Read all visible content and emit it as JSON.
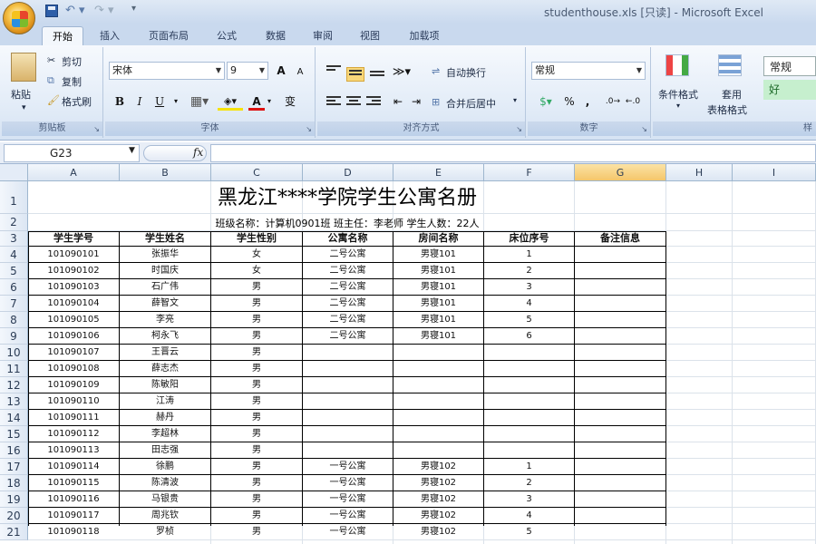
{
  "window": {
    "title": "studenthouse.xls  [只读]  -  Microsoft Excel"
  },
  "quick_access": {
    "save_icon": "save-icon",
    "undo_icon": "undo-icon",
    "redo_icon": "redo-icon"
  },
  "tabs": [
    "开始",
    "插入",
    "页面布局",
    "公式",
    "数据",
    "审阅",
    "视图",
    "加载项"
  ],
  "active_tab": "开始",
  "ribbon": {
    "clipboard": {
      "label": "剪贴板",
      "paste": "粘贴",
      "cut": "剪切",
      "copy": "复制",
      "format_painter": "格式刷"
    },
    "font": {
      "label": "字体",
      "font_name": "宋体",
      "font_size": "9",
      "grow": "A",
      "shrink": "A",
      "bold": "B",
      "italic": "I",
      "underline": "U",
      "font_color": "A",
      "phonetic": "变"
    },
    "alignment": {
      "label": "对齐方式",
      "wrap_text": "自动换行",
      "merge_center": "合并后居中"
    },
    "number": {
      "label": "数字",
      "format": "常规",
      "percent": "%",
      "comma": ","
    },
    "styles": {
      "conditional_format": "条件格式",
      "format_as_table_line1": "套用",
      "format_as_table_line2": "表格格式",
      "style_normal": "常规",
      "style_good": "好",
      "label": "样"
    }
  },
  "formula_bar": {
    "name_box": "G23",
    "fx": "fx",
    "content": ""
  },
  "grid": {
    "columns": [
      "A",
      "B",
      "C",
      "D",
      "E",
      "F",
      "G",
      "H",
      "I"
    ],
    "selected_column": "G",
    "rows": [
      "1",
      "2",
      "3",
      "4",
      "5",
      "6",
      "7",
      "8",
      "9",
      "10",
      "11",
      "12",
      "13",
      "14",
      "15",
      "16",
      "17",
      "18",
      "19",
      "20",
      "21"
    ]
  },
  "sheet": {
    "title": "黑龙江****学院学生公寓名册",
    "subtitle": "班级名称：计算机0901班  班主任：李老师  学生人数：22人",
    "headers": [
      "学生学号",
      "学生姓名",
      "学生性别",
      "公寓名称",
      "房间名称",
      "床位序号",
      "备注信息"
    ],
    "rows": [
      [
        "101090101",
        "张振华",
        "女",
        "二号公寓",
        "男寝101",
        "1",
        ""
      ],
      [
        "101090102",
        "时国庆",
        "女",
        "二号公寓",
        "男寝101",
        "2",
        ""
      ],
      [
        "101090103",
        "石广伟",
        "男",
        "二号公寓",
        "男寝101",
        "3",
        ""
      ],
      [
        "101090104",
        "薛智文",
        "男",
        "二号公寓",
        "男寝101",
        "4",
        ""
      ],
      [
        "101090105",
        "李亮",
        "男",
        "二号公寓",
        "男寝101",
        "5",
        ""
      ],
      [
        "101090106",
        "柯永飞",
        "男",
        "二号公寓",
        "男寝101",
        "6",
        ""
      ],
      [
        "101090107",
        "王晋云",
        "男",
        "",
        "",
        "",
        ""
      ],
      [
        "101090108",
        "薛志杰",
        "男",
        "",
        "",
        "",
        ""
      ],
      [
        "101090109",
        "陈敏阳",
        "男",
        "",
        "",
        "",
        ""
      ],
      [
        "101090110",
        "江涛",
        "男",
        "",
        "",
        "",
        ""
      ],
      [
        "101090111",
        "赫丹",
        "男",
        "",
        "",
        "",
        ""
      ],
      [
        "101090112",
        "李超林",
        "男",
        "",
        "",
        "",
        ""
      ],
      [
        "101090113",
        "田志强",
        "男",
        "",
        "",
        "",
        ""
      ],
      [
        "101090114",
        "徐鹏",
        "男",
        "一号公寓",
        "男寝102",
        "1",
        ""
      ],
      [
        "101090115",
        "陈清波",
        "男",
        "一号公寓",
        "男寝102",
        "2",
        ""
      ],
      [
        "101090116",
        "马银贵",
        "男",
        "一号公寓",
        "男寝102",
        "3",
        ""
      ],
      [
        "101090117",
        "周兆钦",
        "男",
        "一号公寓",
        "男寝102",
        "4",
        ""
      ],
      [
        "101090118",
        "罗桢",
        "男",
        "一号公寓",
        "男寝102",
        "5",
        ""
      ]
    ]
  }
}
